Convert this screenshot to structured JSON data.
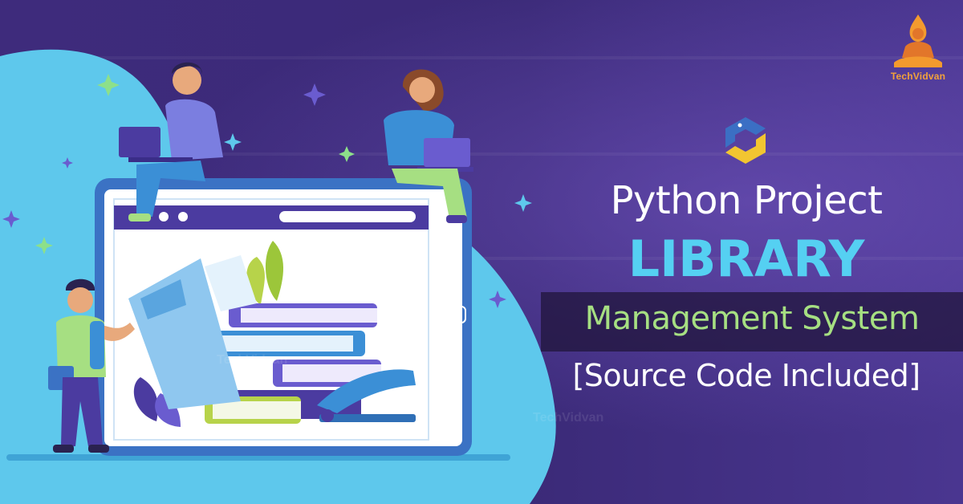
{
  "brand": {
    "logo_text": "TechVidvan",
    "logo_icon": "meditating-figure-icon",
    "accent": "#f3a23a"
  },
  "headline": {
    "line1": "Python Project",
    "line2": "LIBRARY",
    "line3": "Management System",
    "line4": "[Source Code Included]"
  },
  "colors": {
    "background": "#3a2a75",
    "light_blue": "#55d0f2",
    "green": "#a6df82",
    "white": "#ffffff"
  },
  "icons": {
    "python_logo": "python-logo-icon",
    "sparkle": "sparkle-icon"
  }
}
